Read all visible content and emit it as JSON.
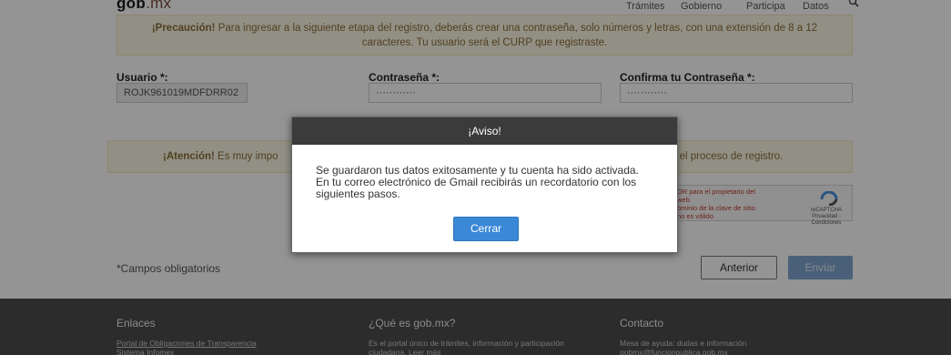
{
  "header": {
    "logo_main": "gob",
    "logo_tld": ".mx",
    "nav": [
      "Trámites",
      "Gobierno",
      "Participa",
      "Datos"
    ],
    "search_icon": "search-icon"
  },
  "warning_top": {
    "bold": "¡Precaución!",
    "text": " Para ingresar a la siguiente etapa del registro, deberás crear una contraseña, solo números y letras, con una extensión de 8 a 12 caracteres. Tu usuario será el CURP que registraste."
  },
  "form": {
    "usuario_label": "Usuario *:",
    "usuario_value": "ROJK961019MDFDRR02",
    "password_label": "Contraseña *:",
    "password_value": "············",
    "confirm_label": "Confirma tu Contraseña *:",
    "confirm_value": "············"
  },
  "warning_mid": {
    "bold": "¡Atención!",
    "left_text": " Es muy impo",
    "right_text": "o el proceso de registro."
  },
  "recaptcha": {
    "error_text": "OR para el propietario del\n web.\nominio de la clave de sitio\n no es válido",
    "brand": "reCAPTCHA",
    "terms": "Privacidad - Condiciones"
  },
  "required_note": "*Campos obligatorios",
  "buttons": {
    "prev": "Anterior",
    "send": "Enviar"
  },
  "footer": {
    "col1_title": "Enlaces",
    "col1_text": "Portal de Obligaciones de Transparencia",
    "col1_text2": "Sistema Infomex",
    "col2_title": "¿Qué es gob.mx?",
    "col2_text": "Es el portal único de trámites, información y participación",
    "col2_text2": "ciudadana. Leer más",
    "col3_title": "Contacto",
    "col3_text": "Mesa de ayuda: dudas e información",
    "col3_text2": "gobmx@funcionpublica.gob.mx"
  },
  "modal": {
    "title": "¡Aviso!",
    "body": "Se guardaron tus datos exitosamente y tu cuenta ha sido activada. En tu correo electrónico de Gmail recibirás un recordatorio con los siguientes pasos.",
    "close": "Cerrar"
  }
}
